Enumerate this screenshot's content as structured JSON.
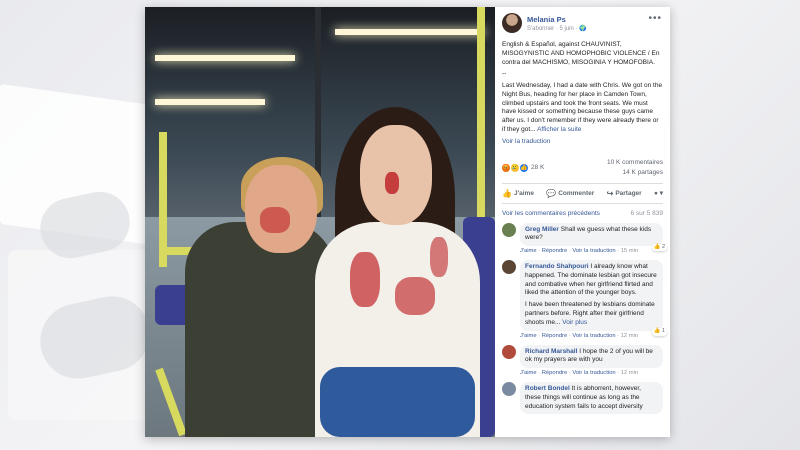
{
  "post": {
    "author": "Melania Ps",
    "meta": "S'abonner · 5 juin · 🌍",
    "bio": "English & Español, against CHAUVINIST, MISOGYNISTIC AND HOMOPHOBIC VIOLENCE / En contra del MACHISMO, MISOGINIA Y HOMOFOBIA.",
    "separator": "--",
    "body": "Last Wednesday, I had a date with Chris. We got on the Night Bus, heading for her place in Camden Town, climbed upstairs and took the front seats. We must have kissed or something because these guys came after us. I don't remember if they were already there or if they got...",
    "see_more": "Afficher la suite",
    "translate": "Voir la traduction",
    "reactions_count": "28 K",
    "comments_count": "10 K commentaires",
    "shares_count": "14 K partages",
    "reaction_icons": [
      "😡",
      "😢",
      "👍"
    ]
  },
  "actions": {
    "like": "J'aime",
    "comment": "Commenter",
    "share": "Partager"
  },
  "comments_header": {
    "previous": "Voir les commentaires précédents",
    "count": "6 sur 5 839"
  },
  "comments": [
    {
      "name": "Greg Miller",
      "text": "Shall we guess what these kids were?",
      "like": "J'aime",
      "reply": "Répondre",
      "translate": "Voir la traduction",
      "time": "15 min",
      "reaction": "2",
      "avatar_color": "#6a7f52"
    },
    {
      "name": "Fernando Shahpouri",
      "text": "I already know what happened. The dominate lesbian got insecure and combative when her girlfriend flirted and liked the attention of the younger boys.",
      "text2": "I have been threatened by lesbians dominate partners before. Right after their girlfriend shoots me...",
      "see_more": "Voir plus",
      "like": "J'aime",
      "reply": "Répondre",
      "translate": "Voir la traduction",
      "time": "12 min",
      "reaction": "1",
      "avatar_color": "#5b4636"
    },
    {
      "name": "Richard Marshall",
      "text": "I hope the 2 of you will be ok my prayers are with you",
      "like": "J'aime",
      "reply": "Répondre",
      "translate": "Voir la traduction",
      "time": "12 min",
      "avatar_color": "#b04a3a"
    },
    {
      "name": "Robert Bondel",
      "text": "It is abhorrent, however, these things will continue as long as the education system fails to accept diversity",
      "avatar_color": "#7a8aa0"
    }
  ],
  "colors": {
    "link": "#365899",
    "muted": "#90949c",
    "bubble": "#f2f3f5",
    "blood": "#c0262b"
  }
}
